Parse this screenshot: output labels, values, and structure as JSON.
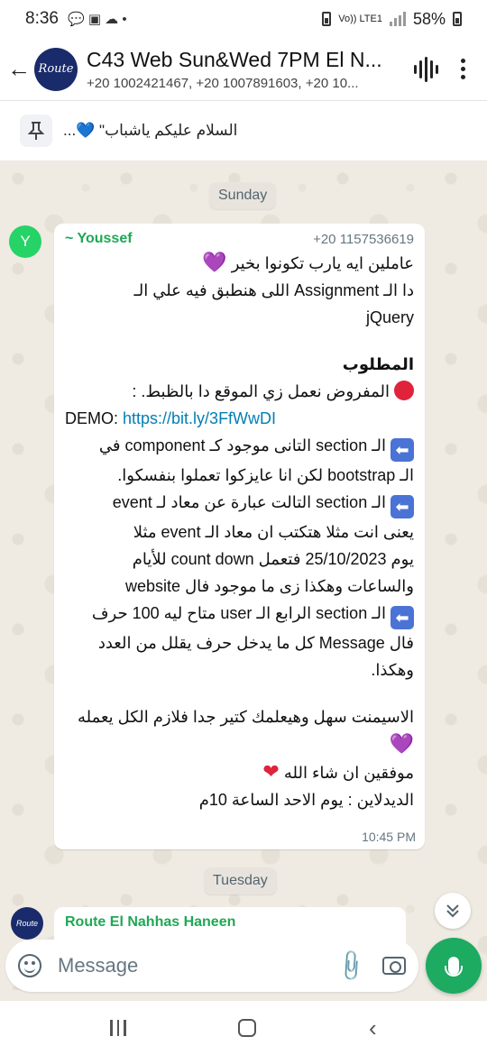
{
  "status_bar": {
    "time": "8:36",
    "battery": "58%",
    "network": "Vo)) LTE1"
  },
  "header": {
    "avatar_text": "Route",
    "title": "C43 Web Sun&Wed 7PM El N...",
    "members": "+20 1002421467, +20 1007891603, +20 10..."
  },
  "pinned": {
    "text": "السلام عليكم ياشباب\" 💙..."
  },
  "dates": {
    "first": "Sunday",
    "second": "Tuesday"
  },
  "message": {
    "avatar_letter": "Y",
    "sender": "~ Youssef",
    "phone": "+20 1157536619",
    "lines": {
      "l1": "عاملين ايه يارب تكونوا بخير",
      "l2": "دا الـ Assignment اللى هنطبق فيه علي الـ",
      "l3": "jQuery",
      "l4": "المطلوب",
      "l5": "المفروض نعمل زي الموقع دا بالظبط. :",
      "l6_prefix": "DEMO: ",
      "l6_link": "https://bit.ly/3FfWwDI",
      "l7": "الـ section التانى موجود كـ component في",
      "l8": "الـ bootstrap لكن انا عايزكوا تعملوا بنفسكوا.",
      "l9": "الـ section التالت عبارة عن معاد لـ event",
      "l10": "يعنى انت مثلا هتكتب ان معاد الـ event مثلا",
      "l11": "يوم 25/10/2023 فتعمل count down للأيام",
      "l12": "والساعات وهكذا زى ما موجود فال website",
      "l13": "الـ section الرابع الـ user متاح ليه 100 حرف",
      "l14": "فال Message كل ما يدخل حرف يقلل من العدد",
      "l15": "وهكذا.",
      "l16": "الاسيمنت سهل وهيعلمك كتير جدا فلازم الكل يعمله",
      "l17": "موفقين ان شاء الله",
      "l18": "الديدلاين : يوم الاحد الساعة 10م"
    },
    "time": "10:45 PM"
  },
  "next_message": {
    "sender": "Route El Nahhas Haneen",
    "avatar_text": "Route"
  },
  "input": {
    "placeholder": "Message"
  },
  "icons": {
    "back": "arrow-left-icon",
    "voice": "voice-chat-icon",
    "menu": "more-vertical-icon",
    "pin": "pin-icon",
    "emoji": "emoji-icon",
    "attach": "paperclip-icon",
    "camera": "camera-icon",
    "mic": "mic-icon",
    "scroll": "chevron-double-down-icon"
  },
  "colors": {
    "accent_green": "#1daa61",
    "sender_green": "#1fa855",
    "link_blue": "#027eb5",
    "wallpaper": "#efeae2"
  }
}
